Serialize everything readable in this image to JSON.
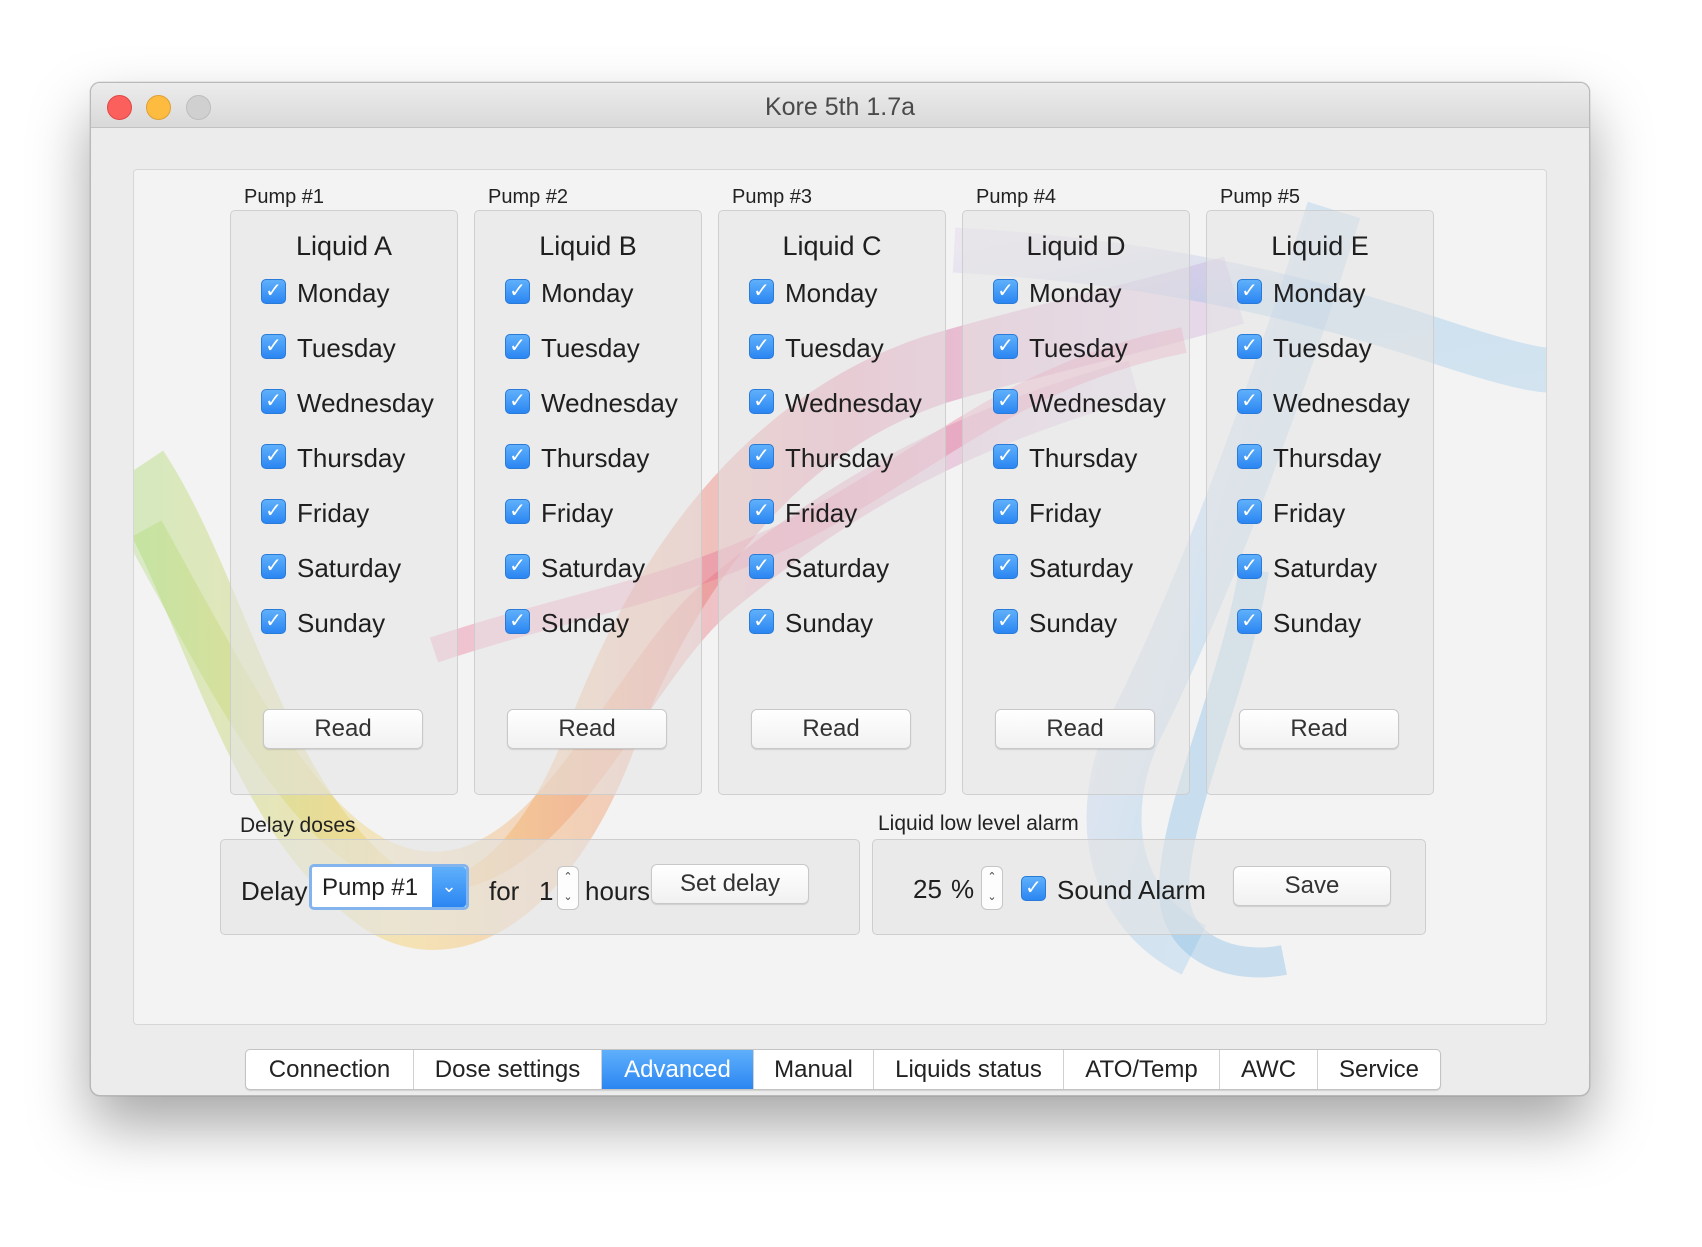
{
  "window": {
    "title": "Kore 5th 1.7a"
  },
  "pumps": [
    {
      "caption": "Pump #1",
      "liquid": "Liquid A",
      "read_label": "Read"
    },
    {
      "caption": "Pump #2",
      "liquid": "Liquid B",
      "read_label": "Read"
    },
    {
      "caption": "Pump #3",
      "liquid": "Liquid C",
      "read_label": "Read"
    },
    {
      "caption": "Pump #4",
      "liquid": "Liquid D",
      "read_label": "Read"
    },
    {
      "caption": "Pump #5",
      "liquid": "Liquid E",
      "read_label": "Read"
    }
  ],
  "days": [
    "Monday",
    "Tuesday",
    "Wednesday",
    "Thursday",
    "Friday",
    "Saturday",
    "Sunday"
  ],
  "checkbox_mark": "✓",
  "delay": {
    "section_label": "Delay doses",
    "delay_label": "Delay",
    "pump_value": "Pump #1",
    "for_label": "for",
    "hours_value": "1",
    "hours_label": "hours",
    "set_delay_label": "Set delay"
  },
  "alarm": {
    "section_label": "Liquid low level alarm",
    "percent_value": "25",
    "percent_sign": "%",
    "sound_alarm_label": "Sound Alarm",
    "save_label": "Save"
  },
  "tabs": [
    {
      "label": "Connection",
      "active": false
    },
    {
      "label": "Dose settings",
      "active": false
    },
    {
      "label": "Advanced",
      "active": true
    },
    {
      "label": "Manual",
      "active": false
    },
    {
      "label": "Liquids status",
      "active": false
    },
    {
      "label": "ATO/Temp",
      "active": false
    },
    {
      "label": "AWC",
      "active": false
    },
    {
      "label": "Service",
      "active": false
    }
  ],
  "icons": {
    "select_arrow": "chevron-down-icon",
    "stepper": "up-down-stepper-icon"
  },
  "colors": {
    "accent": "#2f8cf5",
    "close": "#fc605c",
    "minimize": "#fdbc40"
  }
}
